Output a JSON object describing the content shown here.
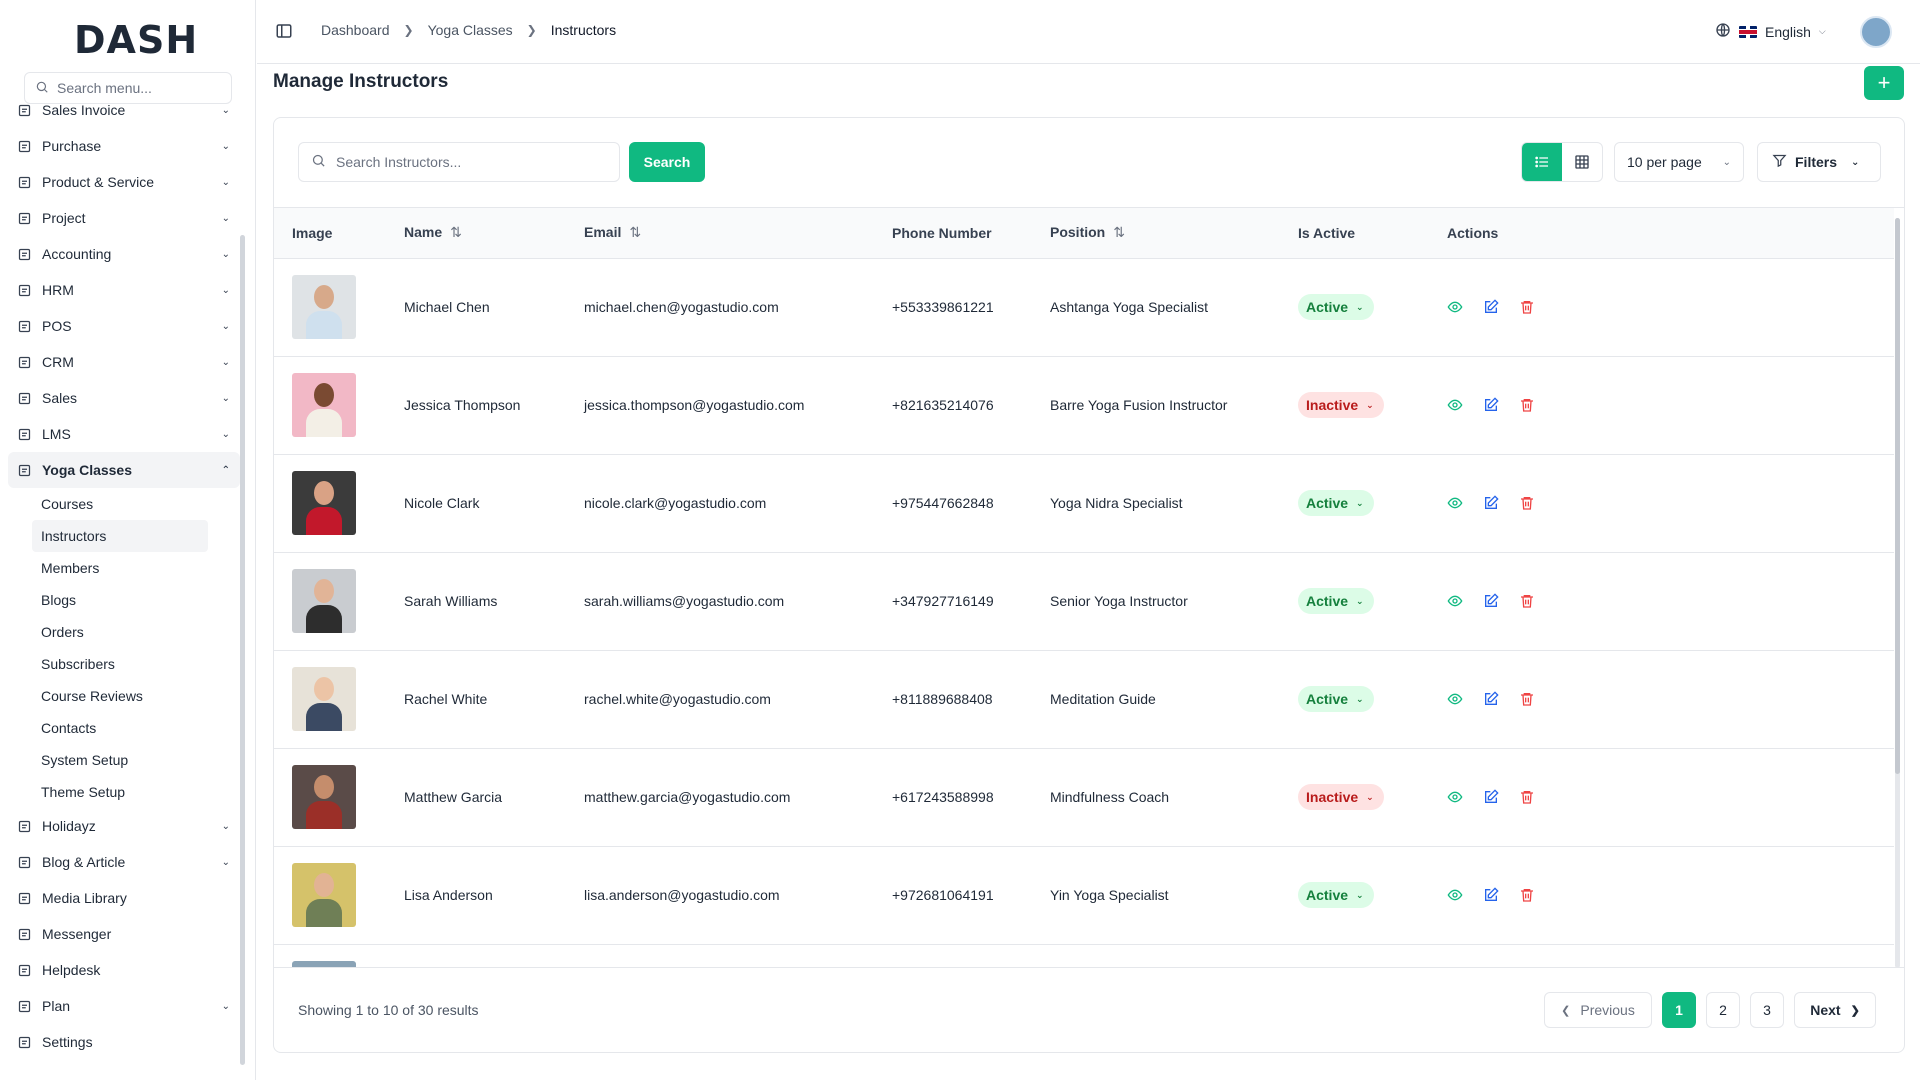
{
  "brand": "DASH",
  "sidebar": {
    "search_placeholder": "Search menu...",
    "items": [
      {
        "label": "Sales Invoice",
        "icon": "invoice-icon"
      },
      {
        "label": "Purchase",
        "icon": "cart-icon"
      },
      {
        "label": "Product & Service",
        "icon": "layers-icon"
      },
      {
        "label": "Project",
        "icon": "folder-icon"
      },
      {
        "label": "Accounting",
        "icon": "calculator-icon"
      },
      {
        "label": "HRM",
        "icon": "users-icon"
      },
      {
        "label": "POS",
        "icon": "store-icon"
      },
      {
        "label": "CRM",
        "icon": "briefcase-icon"
      },
      {
        "label": "Sales",
        "icon": "sales-icon"
      },
      {
        "label": "LMS",
        "icon": "graduation-icon"
      },
      {
        "label": "Yoga Classes",
        "icon": "sun-icon"
      }
    ],
    "yoga_sub": [
      "Courses",
      "Instructors",
      "Members",
      "Blogs",
      "Orders",
      "Subscribers",
      "Course Reviews",
      "Contacts",
      "System Setup",
      "Theme Setup"
    ],
    "items_after": [
      {
        "label": "Holidayz",
        "icon": "holiday-icon",
        "chevron": true
      },
      {
        "label": "Blog & Article",
        "icon": "article-icon",
        "chevron": true
      },
      {
        "label": "Media Library",
        "icon": "image-icon",
        "chevron": false
      },
      {
        "label": "Messenger",
        "icon": "chat-icon",
        "chevron": false
      },
      {
        "label": "Helpdesk",
        "icon": "headset-icon",
        "chevron": false
      },
      {
        "label": "Plan",
        "icon": "plan-icon",
        "chevron": true
      },
      {
        "label": "Settings",
        "icon": "gear-icon",
        "chevron": false
      }
    ]
  },
  "topbar": {
    "breadcrumb": [
      "Dashboard",
      "Yoga Classes",
      "Instructors"
    ],
    "language": "English"
  },
  "page": {
    "title": "Manage Instructors",
    "search_placeholder": "Search Instructors...",
    "search_label": "Search",
    "per_page": "10 per page",
    "filters_label": "Filters"
  },
  "table": {
    "headers": [
      "Image",
      "Name",
      "Email",
      "Phone Number",
      "Position",
      "Is Active",
      "Actions"
    ],
    "rows": [
      {
        "name": "Michael Chen",
        "email": "michael.chen@yogastudio.com",
        "phone": "+553339861221",
        "position": "Ashtanga Yoga Specialist",
        "status": "Active",
        "bg": "#dfe3e6",
        "shirt": "#cfe0ee",
        "skin": "#d7a98a"
      },
      {
        "name": "Jessica Thompson",
        "email": "jessica.thompson@yogastudio.com",
        "phone": "+821635214076",
        "position": "Barre Yoga Fusion Instructor",
        "status": "Inactive",
        "bg": "#f2b8c6",
        "shirt": "#f3efe6",
        "skin": "#7a4a32"
      },
      {
        "name": "Nicole Clark",
        "email": "nicole.clark@yogastudio.com",
        "phone": "+975447662848",
        "position": "Yoga Nidra Specialist",
        "status": "Active",
        "bg": "#3b3b3b",
        "shirt": "#c2182b",
        "skin": "#d9a285"
      },
      {
        "name": "Sarah Williams",
        "email": "sarah.williams@yogastudio.com",
        "phone": "+347927716149",
        "position": "Senior Yoga Instructor",
        "status": "Active",
        "bg": "#c9ccd0",
        "shirt": "#2d2d2d",
        "skin": "#e1b497"
      },
      {
        "name": "Rachel White",
        "email": "rachel.white@yogastudio.com",
        "phone": "+811889688408",
        "position": "Meditation Guide",
        "status": "Active",
        "bg": "#e7e2d8",
        "shirt": "#3b4a63",
        "skin": "#ecc4a6"
      },
      {
        "name": "Matthew Garcia",
        "email": "matthew.garcia@yogastudio.com",
        "phone": "+617243588998",
        "position": "Mindfulness Coach",
        "status": "Inactive",
        "bg": "#5a4b48",
        "shirt": "#9b2f28",
        "skin": "#c58d6c"
      },
      {
        "name": "Lisa Anderson",
        "email": "lisa.anderson@yogastudio.com",
        "phone": "+972681064191",
        "position": "Yin Yoga Specialist",
        "status": "Active",
        "bg": "#d5c26a",
        "shirt": "#6f7f56",
        "skin": "#e2b394"
      },
      {
        "name": "",
        "email": "",
        "phone": "",
        "position": "",
        "status": "",
        "bg": "#8aa3b6",
        "shirt": "#8aa3b6",
        "skin": "#d9a98a"
      }
    ]
  },
  "footer": {
    "showing": "Showing 1 to 10 of 30 results",
    "prev": "Previous",
    "next": "Next",
    "pages": [
      "1",
      "2",
      "3"
    ]
  },
  "colors": {
    "accent": "#10b981",
    "active_bg": "#dcfce7",
    "inactive_bg": "#fee2e2"
  }
}
